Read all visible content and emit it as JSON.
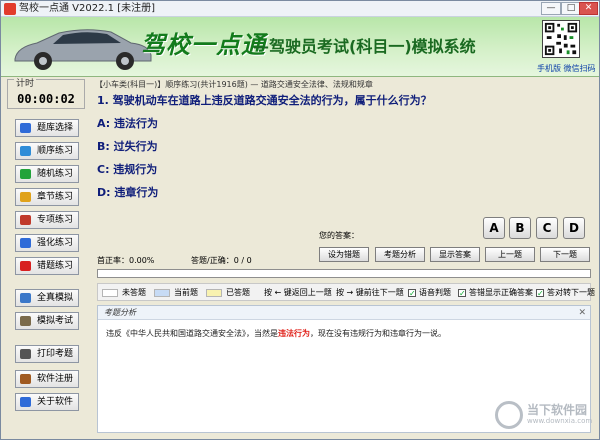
{
  "window": {
    "title": "驾校一点通 V2022.1 [未注册]",
    "min_glyph": "—",
    "max_glyph": "□",
    "close_glyph": "✕"
  },
  "banner": {
    "logo": "驾校一点通",
    "subtitle": "—驾驶员考试(科目一)模拟系统",
    "qr_caption": "手机版 微信扫码",
    "qr_icon": "qr-code-icon",
    "car_icon": "car-icon"
  },
  "timer": {
    "label": "计时",
    "value": "00:00:02"
  },
  "sidebar": {
    "items": [
      {
        "label": "题库选择",
        "icon": "book-icon",
        "color": "#2f6bd8"
      },
      {
        "label": "顺序练习",
        "icon": "arrow-right-icon",
        "color": "#2f8dd8"
      },
      {
        "label": "随机练习",
        "icon": "shuffle-icon",
        "color": "#22a33a"
      },
      {
        "label": "章节练习",
        "icon": "chapter-icon",
        "color": "#e0a21a"
      },
      {
        "label": "专项练习",
        "icon": "check-icon",
        "color": "#c0392b"
      },
      {
        "label": "强化练习",
        "icon": "chart-icon",
        "color": "#2f6bd8"
      },
      {
        "label": "错题练习",
        "icon": "flag-icon",
        "color": "#d82020"
      },
      {
        "label": "全真模拟",
        "icon": "monitor-icon",
        "color": "#3b78c9"
      },
      {
        "label": "模拟考试",
        "icon": "exam-icon",
        "color": "#7a6a4a"
      },
      {
        "label": "打印考题",
        "icon": "printer-icon",
        "color": "#555555"
      },
      {
        "label": "软件注册",
        "icon": "key-icon",
        "color": "#a05a20"
      },
      {
        "label": "关于软件",
        "icon": "info-icon",
        "color": "#2f6bd8"
      }
    ]
  },
  "question": {
    "header": "【小车类(科目一)】顺序练习(共计1916题) — 道路交通安全法律、法规和规章",
    "text": "1. 驾驶机动车在道路上违反道路交通安全法的行为，属于什么行为？",
    "options": [
      "A: 违法行为",
      "B: 过失行为",
      "C: 违规行为",
      "D: 违章行为"
    ]
  },
  "answer": {
    "label": "您的答案：",
    "choices": [
      "A",
      "B",
      "C",
      "D"
    ]
  },
  "stats": {
    "rate": "首正率：0.00%",
    "count": "答题/正确：0 / 0"
  },
  "actions": {
    "favorite": "设为错题",
    "analysis": "考题分析",
    "show_answer": "显示答案",
    "prev": "上一题",
    "next": "下一题"
  },
  "progress": {
    "fraction": 0.0
  },
  "legend": {
    "unanswered": "未答题",
    "current": "当前题",
    "answered": "已答题",
    "key_prev": "按 ← 键返回上一题",
    "key_next": "按 → 键前往下一题",
    "voice": "语音判题",
    "show_correct": "答错显示正确答案",
    "auto_next": "答对转下一题",
    "colors": {
      "unanswered": "#ffffff",
      "current": "#c7dbf5",
      "answered": "#f8f2b0"
    }
  },
  "analysis": {
    "title": "考题分析",
    "close_glyph": "✕",
    "text_before": "违反《中华人民共和国道路交通安全法》，当然是",
    "highlight": "违法行为",
    "text_after": "，现在没有违规行为和违章行为一说。"
  },
  "watermark": {
    "text": "当下软件园",
    "url": "www.downxia.com"
  }
}
